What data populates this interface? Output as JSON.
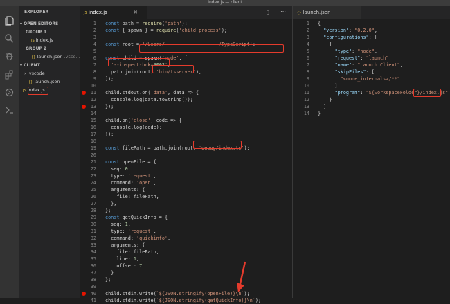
{
  "window": {
    "title": "index.js — client"
  },
  "activity": {
    "icons": [
      "files-icon",
      "search-icon",
      "debug-icon",
      "extensions-icon",
      "git-icon",
      "remote-icon"
    ]
  },
  "sidebar": {
    "explorer_label": "EXPLORER",
    "open_editors_label": "OPEN EDITORS",
    "group1_label": "GROUP 1",
    "group1_file": "index.js",
    "group2_label": "GROUP 2",
    "group2_file": "launch.json",
    "group2_path": ".vsco...",
    "client_label": "CLIENT",
    "vscode_folder": ".vscode",
    "vscode_file": "launch.json",
    "root_file": "index.js"
  },
  "editor_left": {
    "tab_label": "index.js",
    "lines": [
      {
        "n": "1",
        "t": "const path = require('path');"
      },
      {
        "n": "2",
        "t": "const { spawn } = require('child_process');"
      },
      {
        "n": "3",
        "t": ""
      },
      {
        "n": "4",
        "t": "const root = '/Users/                   /TypeScript';"
      },
      {
        "n": "5",
        "t": ""
      },
      {
        "n": "6",
        "t": "const child = spawn('node', ["
      },
      {
        "n": "7",
        "t": "  '--inspect-brk=9002',"
      },
      {
        "n": "8",
        "t": "  path.join(root, 'bin/tsserver'),"
      },
      {
        "n": "9",
        "t": "]);"
      },
      {
        "n": "10",
        "t": ""
      },
      {
        "n": "11",
        "t": "child.stdout.on('data', data => {"
      },
      {
        "n": "12",
        "t": "  console.log(data.toString());"
      },
      {
        "n": "13",
        "t": "});"
      },
      {
        "n": "14",
        "t": ""
      },
      {
        "n": "15",
        "t": "child.on('close', code => {"
      },
      {
        "n": "16",
        "t": "  console.log(code);"
      },
      {
        "n": "17",
        "t": "});"
      },
      {
        "n": "18",
        "t": ""
      },
      {
        "n": "19",
        "t": "const filePath = path.join(root, 'debug/index.ts');"
      },
      {
        "n": "20",
        "t": ""
      },
      {
        "n": "21",
        "t": "const openFile = {"
      },
      {
        "n": "22",
        "t": "  seq: 0,"
      },
      {
        "n": "23",
        "t": "  type: 'request',"
      },
      {
        "n": "24",
        "t": "  command: 'open',"
      },
      {
        "n": "25",
        "t": "  arguments: {"
      },
      {
        "n": "26",
        "t": "    file: filePath,"
      },
      {
        "n": "27",
        "t": "  },"
      },
      {
        "n": "28",
        "t": "};"
      },
      {
        "n": "29",
        "t": "const getQuickInfo = {"
      },
      {
        "n": "30",
        "t": "  seq: 1,"
      },
      {
        "n": "31",
        "t": "  type: 'request',"
      },
      {
        "n": "32",
        "t": "  command: 'quickinfo',"
      },
      {
        "n": "33",
        "t": "  arguments: {"
      },
      {
        "n": "34",
        "t": "    file: filePath,"
      },
      {
        "n": "35",
        "t": "    line: 1,"
      },
      {
        "n": "36",
        "t": "    offset: 7"
      },
      {
        "n": "37",
        "t": "  }"
      },
      {
        "n": "38",
        "t": "};"
      },
      {
        "n": "39",
        "t": ""
      },
      {
        "n": "40",
        "t": "child.stdin.write(`${JSON.stringify(openFile)}\\n`);"
      },
      {
        "n": "41",
        "t": "child.stdin.write(`${JSON.stringify(getQuickInfo)}\\n`);"
      }
    ],
    "breakpoints": [
      "11",
      "13",
      "40"
    ]
  },
  "editor_right": {
    "tab_label": "launch.json",
    "lines": [
      {
        "n": "1",
        "t": "{"
      },
      {
        "n": "2",
        "t": "  \"version\": \"0.2.0\","
      },
      {
        "n": "3",
        "t": "  \"configurations\": ["
      },
      {
        "n": "4",
        "t": "    {"
      },
      {
        "n": "5",
        "t": "      \"type\": \"node\","
      },
      {
        "n": "6",
        "t": "      \"request\": \"launch\","
      },
      {
        "n": "7",
        "t": "      \"name\": \"Launch Client\","
      },
      {
        "n": "8",
        "t": "      \"skipFiles\": ["
      },
      {
        "n": "9",
        "t": "        \"<node_internals>/**\""
      },
      {
        "n": "10",
        "t": "      ],"
      },
      {
        "n": "11",
        "t": "      \"program\": \"${workspaceFolder}/index.js\""
      },
      {
        "n": "12",
        "t": "    }"
      },
      {
        "n": "13",
        "t": "  ]"
      },
      {
        "n": "14",
        "t": "}"
      }
    ]
  }
}
